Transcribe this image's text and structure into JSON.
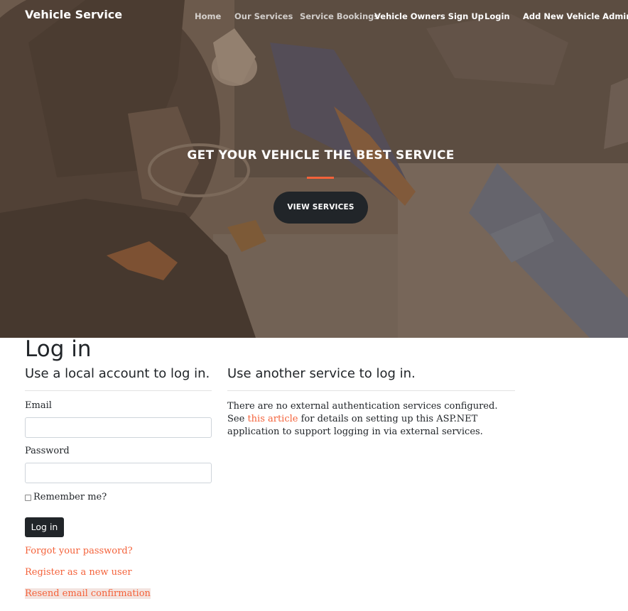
{
  "navbar": {
    "brand": "Vehicle Service",
    "links": [
      {
        "label": "Home"
      },
      {
        "label": "Our Services"
      },
      {
        "label": "Service Bookings"
      },
      {
        "label": "Vehicle Owners Sign Up"
      },
      {
        "label": "Login"
      },
      {
        "label": "Add New Vehicle Admin"
      }
    ]
  },
  "hero": {
    "title": "GET YOUR VEHICLE THE BEST SERVICE",
    "button_label": "VIEW SERVICES"
  },
  "login": {
    "page_title": "Log in",
    "local_heading": "Use a local account to log in.",
    "email_label": "Email",
    "email_value": "",
    "password_label": "Password",
    "password_value": "",
    "remember_label": "Remember me?",
    "remember_checked": false,
    "submit_label": "Log in",
    "links": {
      "forgot": "Forgot your password?",
      "register": "Register as a new user",
      "resend": "Resend email confirmation"
    }
  },
  "external": {
    "heading": "Use another service to log in.",
    "text_before": "There are no external authentication services configured. See ",
    "link_text": "this article",
    "text_after": " for details on setting up this ASP.NET application to support logging in via external services."
  },
  "colors": {
    "accent": "#f4623a",
    "dark": "#212529",
    "hero_overlay": "#5c483a"
  }
}
